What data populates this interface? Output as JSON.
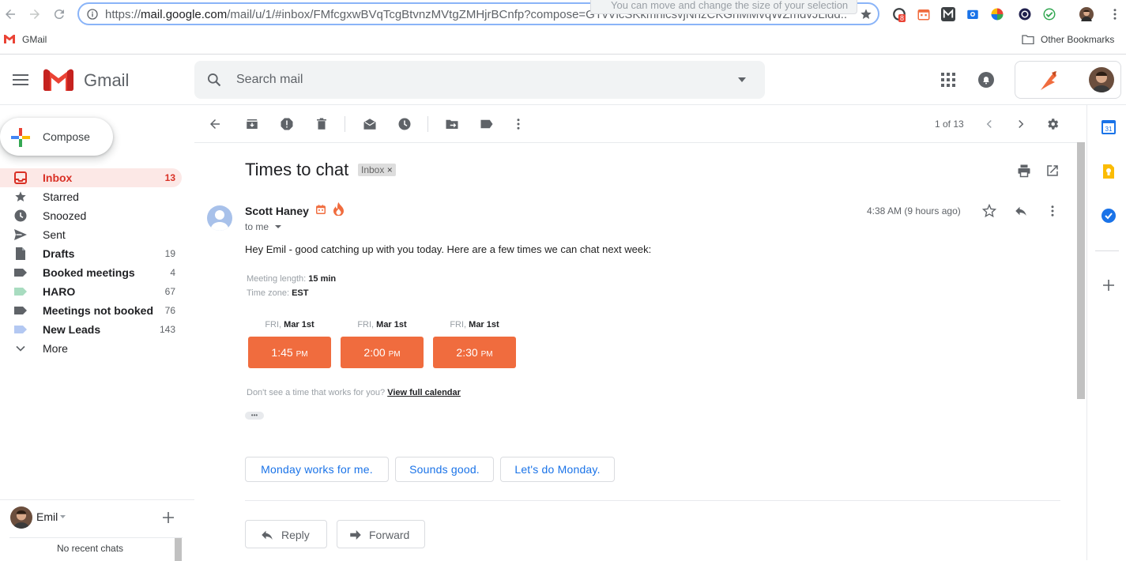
{
  "browser": {
    "url_scheme": "https://",
    "url_domain": "mail.google.com",
    "url_path": "/mail/u/1/#inbox/FMfcgxwBVqTcgBtvnzMVtgZMHjrBCnfp?compose=GTvVlcSKkmnicsvjNnzCKGhMMvqWZmdvJLldd...",
    "tooltip": "You can move and change the size of your selection",
    "ext_badge": "8",
    "bookmark_gmail": "GMail",
    "bookmark_other": "Other Bookmarks"
  },
  "header": {
    "app_name": "Gmail",
    "search_placeholder": "Search mail"
  },
  "sidebar": {
    "compose": "Compose",
    "items": [
      {
        "label": "Inbox",
        "count": "13"
      },
      {
        "label": "Starred",
        "count": ""
      },
      {
        "label": "Snoozed",
        "count": ""
      },
      {
        "label": "Sent",
        "count": ""
      },
      {
        "label": "Drafts",
        "count": "19"
      },
      {
        "label": "Booked meetings",
        "count": "4"
      },
      {
        "label": "HARO",
        "count": "67"
      },
      {
        "label": "Meetings not booked",
        "count": "76"
      },
      {
        "label": "New Leads",
        "count": "143"
      },
      {
        "label": "More",
        "count": ""
      }
    ],
    "label_colors": {
      "booked": "#5f6368",
      "haro": "#a8dcc0",
      "not_booked": "#5f6368",
      "new_leads": "#b3c8f2"
    },
    "chat_user": "Emil",
    "no_chats": "No recent chats"
  },
  "toolbar": {
    "pagination": "1 of 13"
  },
  "message": {
    "subject": "Times to chat",
    "label_chip": "Inbox",
    "sender": "Scott Haney",
    "recipient": "to me",
    "time": "4:38 AM (9 hours ago)",
    "body_intro": "Hey Emil - good catching up with you today. Here are a few times we can chat next week:",
    "meeting_length_label": "Meeting length:",
    "meeting_length_value": "15 min",
    "timezone_label": "Time zone:",
    "timezone_value": "EST",
    "slots": [
      {
        "dow": "FRI,",
        "date": "Mar 1st",
        "time": "1:45",
        "ampm": "PM"
      },
      {
        "dow": "FRI,",
        "date": "Mar 1st",
        "time": "2:00",
        "ampm": "PM"
      },
      {
        "dow": "FRI,",
        "date": "Mar 1st",
        "time": "2:30",
        "ampm": "PM"
      }
    ],
    "calendar_prompt": "Don't see a time that works for you?",
    "calendar_link": "View full calendar",
    "ellipsis": "•••",
    "smart_replies": [
      "Monday works for me.",
      "Sounds good.",
      "Let's do Monday."
    ],
    "reply": "Reply",
    "forward": "Forward"
  },
  "colors": {
    "accent_orange": "#f06c3e",
    "inbox_red": "#d93025",
    "link_blue": "#1a73e8"
  }
}
